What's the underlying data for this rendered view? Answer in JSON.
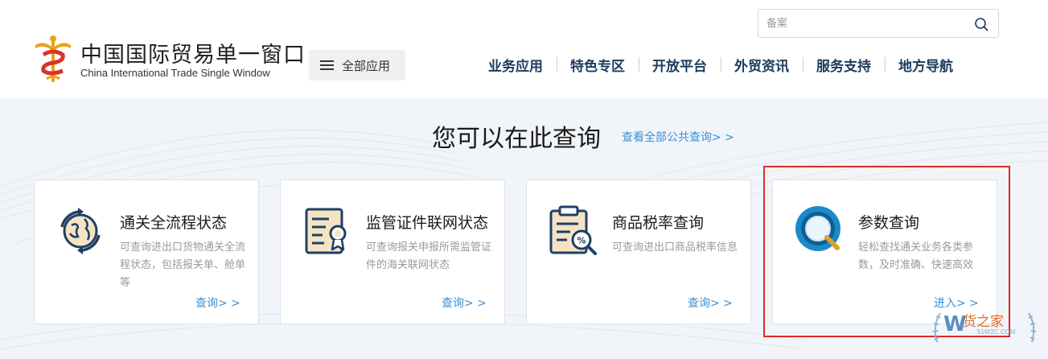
{
  "header": {
    "logo_cn": "中国国际贸易单一窗口",
    "logo_en": "China International Trade Single Window",
    "all_apps_label": "全部应用",
    "search": {
      "placeholder": "备案"
    },
    "nav": [
      "业务应用",
      "特色专区",
      "开放平台",
      "外贸资讯",
      "服务支持",
      "地方导航"
    ]
  },
  "main": {
    "title": "您可以在此查询",
    "view_all": "查看全部公共查询> >",
    "cards": [
      {
        "icon": "globe-refresh-icon",
        "title": "通关全流程状态",
        "desc": "可查询进出口货物通关全流程状态，包括报关单、舱单等",
        "link": "查询> >"
      },
      {
        "icon": "certificate-icon",
        "title": "监管证件联网状态",
        "desc": "可查询报关申报所需监管证件的海关联网状态",
        "link": "查询> >"
      },
      {
        "icon": "clipboard-percent-icon",
        "title": "商品税率查询",
        "desc": "可查询进出口商品税率信息",
        "link": "查询> >"
      },
      {
        "icon": "magnifier-icon",
        "title": "参数查询",
        "desc": "轻松查找通关业务各类参数，及时准确、快速高效",
        "link": "进入> >"
      }
    ]
  },
  "watermark": {
    "text": "货之家",
    "sub": "51W2C.COM"
  },
  "colors": {
    "accent": "#3c8fd3",
    "nav": "#1c3b5c",
    "highlight": "#e02a2a",
    "icon_navy": "#1f3f66",
    "icon_beige": "#f5e4c3"
  }
}
